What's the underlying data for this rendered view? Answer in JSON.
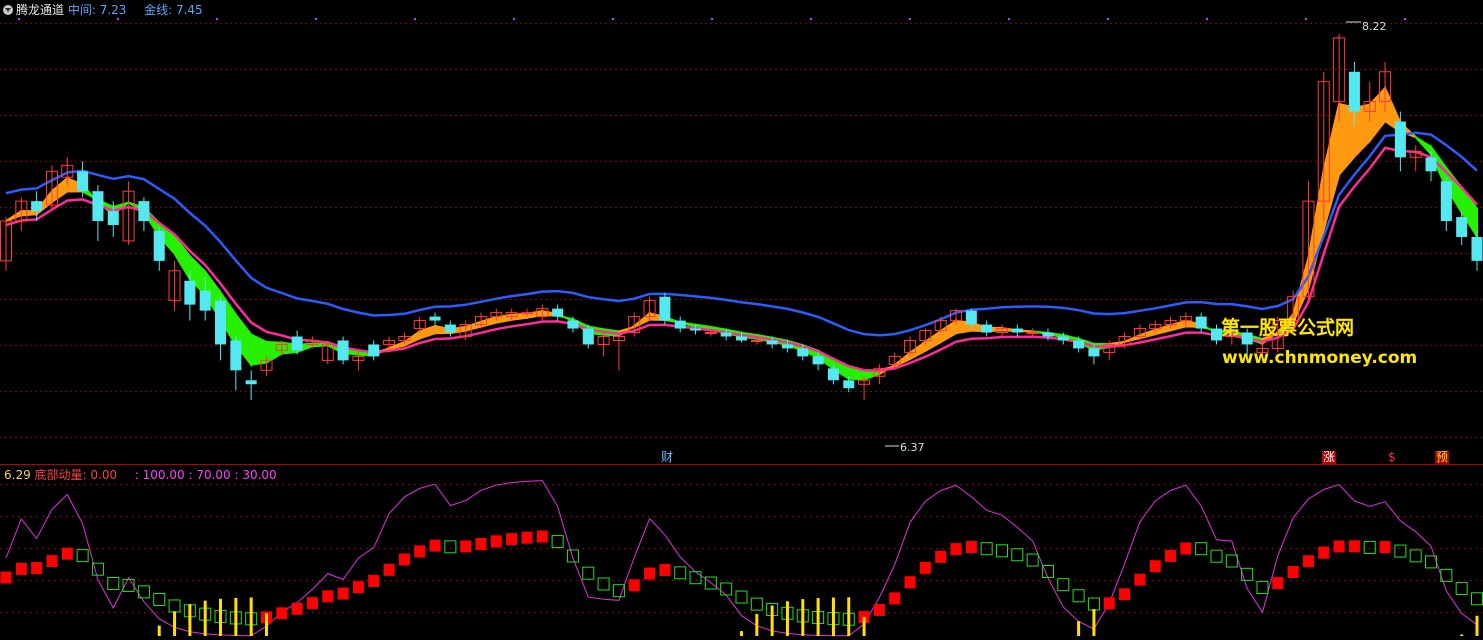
{
  "main_panel": {
    "title": "腾龙通道",
    "indicators": [
      {
        "label": "中间",
        "value": "7.23"
      },
      {
        "label": "金线",
        "value": "7.45"
      }
    ],
    "high_marker": "8.22",
    "low_marker": "6.37",
    "tags": {
      "cai": "财",
      "zhang": "涨",
      "dollar": "$",
      "yu": "预"
    },
    "watermark_1": "第一股票公式网",
    "watermark_2": "www.chnmoney.com"
  },
  "sub_panel": {
    "value": "6.29",
    "name": "底部动量",
    "name_value": ": 0.00",
    "levels": ": 100.00 : 70.00 : 30.00"
  },
  "colors": {
    "background": "#000000",
    "up_candle": "#ff3b3b",
    "down_candle": "#54e8f0",
    "upper_band": "#2a5cff",
    "lower_band": "#ff2a9c",
    "gold_band": "#ff9a10",
    "green_band": "#25f000",
    "oscillator": "#e030e0",
    "grid": "#8a0000"
  },
  "chart_data": {
    "type": "candlestick",
    "price_range": [
      6.2,
      8.3
    ],
    "candles": [
      [
        7.1,
        7.3,
        7.05,
        7.32
      ],
      [
        7.3,
        7.4,
        7.25,
        7.42
      ],
      [
        7.4,
        7.35,
        7.3,
        7.45
      ],
      [
        7.38,
        7.55,
        7.35,
        7.58
      ],
      [
        7.52,
        7.58,
        7.48,
        7.62
      ],
      [
        7.55,
        7.45,
        7.42,
        7.6
      ],
      [
        7.45,
        7.3,
        7.2,
        7.48
      ],
      [
        7.35,
        7.28,
        7.22,
        7.4
      ],
      [
        7.2,
        7.45,
        7.18,
        7.5
      ],
      [
        7.4,
        7.3,
        7.25,
        7.42
      ],
      [
        7.25,
        7.1,
        7.05,
        7.27
      ],
      [
        6.9,
        7.05,
        6.85,
        7.1
      ],
      [
        7.0,
        6.88,
        6.8,
        7.05
      ],
      [
        6.95,
        6.85,
        6.8,
        7.02
      ],
      [
        6.9,
        6.68,
        6.6,
        6.92
      ],
      [
        6.7,
        6.55,
        6.45,
        6.72
      ],
      [
        6.5,
        6.48,
        6.4,
        6.55
      ],
      [
        6.55,
        6.6,
        6.52,
        6.62
      ],
      [
        6.65,
        6.68,
        6.62,
        6.7
      ],
      [
        6.72,
        6.65,
        6.63,
        6.75
      ],
      [
        6.68,
        6.7,
        6.66,
        6.72
      ],
      [
        6.6,
        6.68,
        6.58,
        6.7
      ],
      [
        6.7,
        6.6,
        6.58,
        6.72
      ],
      [
        6.6,
        6.62,
        6.55,
        6.65
      ],
      [
        6.68,
        6.62,
        6.6,
        6.7
      ],
      [
        6.68,
        6.7,
        6.66,
        6.72
      ],
      [
        6.7,
        6.72,
        6.68,
        6.74
      ],
      [
        6.76,
        6.8,
        6.74,
        6.82
      ],
      [
        6.82,
        6.8,
        6.78,
        6.84
      ],
      [
        6.78,
        6.74,
        6.72,
        6.8
      ],
      [
        6.72,
        6.78,
        6.7,
        6.8
      ],
      [
        6.78,
        6.82,
        6.76,
        6.84
      ],
      [
        6.82,
        6.84,
        6.8,
        6.86
      ],
      [
        6.82,
        6.84,
        6.8,
        6.86
      ],
      [
        6.84,
        6.84,
        6.82,
        6.86
      ],
      [
        6.82,
        6.86,
        6.8,
        6.88
      ],
      [
        6.86,
        6.82,
        6.8,
        6.88
      ],
      [
        6.8,
        6.76,
        6.74,
        6.82
      ],
      [
        6.76,
        6.68,
        6.66,
        6.78
      ],
      [
        6.68,
        6.72,
        6.62,
        6.74
      ],
      [
        6.7,
        6.72,
        6.55,
        6.74
      ],
      [
        6.74,
        6.82,
        6.72,
        6.84
      ],
      [
        6.82,
        6.9,
        6.8,
        6.92
      ],
      [
        6.92,
        6.8,
        6.78,
        6.94
      ],
      [
        6.8,
        6.76,
        6.74,
        6.82
      ],
      [
        6.76,
        6.75,
        6.73,
        6.78
      ],
      [
        6.74,
        6.74,
        6.72,
        6.76
      ],
      [
        6.74,
        6.72,
        6.7,
        6.76
      ],
      [
        6.72,
        6.7,
        6.69,
        6.74
      ],
      [
        6.7,
        6.7,
        6.68,
        6.72
      ],
      [
        6.7,
        6.68,
        6.66,
        6.72
      ],
      [
        6.68,
        6.66,
        6.64,
        6.7
      ],
      [
        6.66,
        6.62,
        6.6,
        6.68
      ],
      [
        6.62,
        6.58,
        6.55,
        6.64
      ],
      [
        6.56,
        6.5,
        6.48,
        6.58
      ],
      [
        6.5,
        6.46,
        6.44,
        6.52
      ],
      [
        6.48,
        6.5,
        6.4,
        6.52
      ],
      [
        6.52,
        6.56,
        6.48,
        6.58
      ],
      [
        6.58,
        6.62,
        6.56,
        6.64
      ],
      [
        6.64,
        6.7,
        6.62,
        6.72
      ],
      [
        6.7,
        6.75,
        6.68,
        6.76
      ],
      [
        6.75,
        6.8,
        6.74,
        6.82
      ],
      [
        6.8,
        6.85,
        6.78,
        6.86
      ],
      [
        6.85,
        6.78,
        6.76,
        6.86
      ],
      [
        6.78,
        6.74,
        6.72,
        6.8
      ],
      [
        6.74,
        6.76,
        6.72,
        6.78
      ],
      [
        6.76,
        6.74,
        6.72,
        6.78
      ],
      [
        6.74,
        6.74,
        6.72,
        6.76
      ],
      [
        6.74,
        6.72,
        6.7,
        6.76
      ],
      [
        6.72,
        6.7,
        6.68,
        6.74
      ],
      [
        6.7,
        6.66,
        6.64,
        6.72
      ],
      [
        6.66,
        6.62,
        6.58,
        6.68
      ],
      [
        6.64,
        6.68,
        6.6,
        6.7
      ],
      [
        6.68,
        6.72,
        6.66,
        6.74
      ],
      [
        6.72,
        6.76,
        6.7,
        6.78
      ],
      [
        6.76,
        6.78,
        6.74,
        6.8
      ],
      [
        6.78,
        6.8,
        6.76,
        6.82
      ],
      [
        6.8,
        6.82,
        6.76,
        6.84
      ],
      [
        6.82,
        6.76,
        6.74,
        6.84
      ],
      [
        6.76,
        6.7,
        6.68,
        6.78
      ],
      [
        6.72,
        6.74,
        6.68,
        6.76
      ],
      [
        6.74,
        6.68,
        6.62,
        6.76
      ],
      [
        6.64,
        6.66,
        6.62,
        6.7
      ],
      [
        6.66,
        6.8,
        6.64,
        6.82
      ],
      [
        6.8,
        6.92,
        6.78,
        6.95
      ],
      [
        6.92,
        7.4,
        6.9,
        7.5
      ],
      [
        7.4,
        8.0,
        7.3,
        8.05
      ],
      [
        7.9,
        8.22,
        7.8,
        8.24
      ],
      [
        8.05,
        7.85,
        7.78,
        8.1
      ],
      [
        7.85,
        7.9,
        7.8,
        8.0
      ],
      [
        7.9,
        8.05,
        7.85,
        8.1
      ],
      [
        7.8,
        7.62,
        7.55,
        7.85
      ],
      [
        7.62,
        7.65,
        7.55,
        7.68
      ],
      [
        7.62,
        7.55,
        7.5,
        7.65
      ],
      [
        7.5,
        7.3,
        7.25,
        7.52
      ],
      [
        7.32,
        7.22,
        7.18,
        7.35
      ],
      [
        7.22,
        7.1,
        7.05,
        7.25
      ]
    ]
  }
}
